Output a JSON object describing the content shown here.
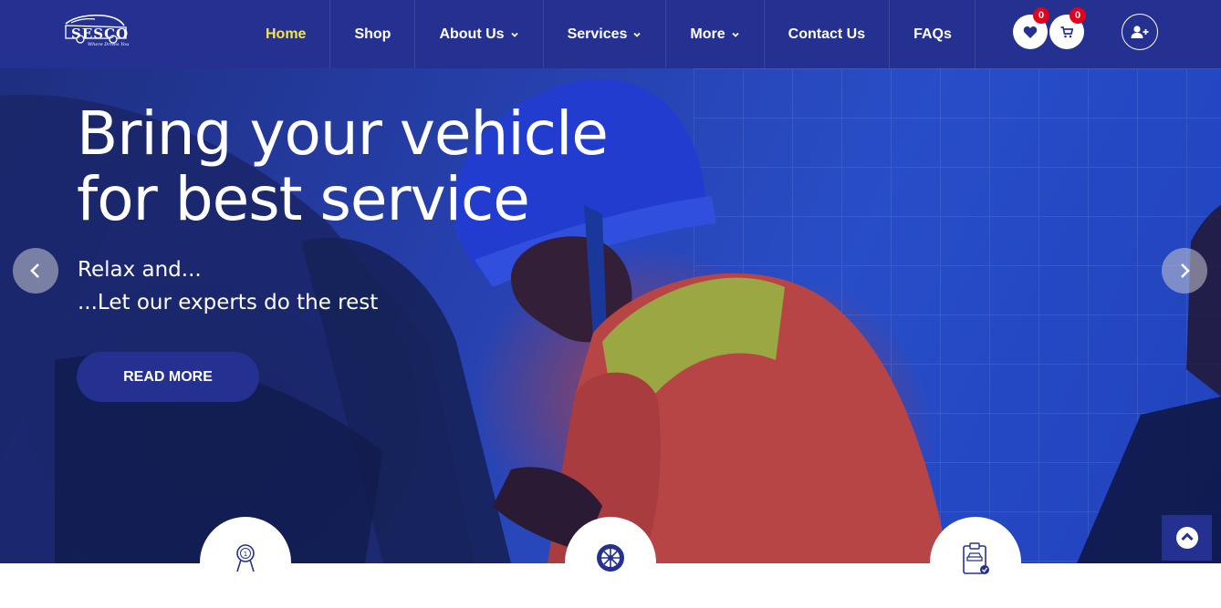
{
  "header": {
    "logo_text": "SESCO",
    "logo_tagline": "Where Drives You",
    "nav": [
      {
        "label": "Home",
        "active": true,
        "dropdown": false
      },
      {
        "label": "Shop",
        "active": false,
        "dropdown": false
      },
      {
        "label": "About Us",
        "active": false,
        "dropdown": true
      },
      {
        "label": "Services",
        "active": false,
        "dropdown": true
      },
      {
        "label": "More",
        "active": false,
        "dropdown": true
      },
      {
        "label": "Contact Us",
        "active": false,
        "dropdown": false
      },
      {
        "label": "FAQs",
        "active": false,
        "dropdown": false
      }
    ],
    "wishlist_count": "0",
    "cart_count": "0",
    "icons": {
      "wishlist": "heart-icon",
      "cart": "cart-icon",
      "account": "user-plus-icon"
    }
  },
  "hero": {
    "title_line1": "Bring your vehicle",
    "title_line2": "for best service",
    "subtitle_line1": "Relax and...",
    "subtitle_line2": "...Let our experts do the rest",
    "button_label": "READ MORE",
    "prev_icon": "chevron-left-icon",
    "next_icon": "chevron-right-icon"
  },
  "features": [
    {
      "icon": "award-ribbon-icon"
    },
    {
      "icon": "wheel-icon"
    },
    {
      "icon": "clipboard-car-icon"
    }
  ],
  "scroll_top_icon": "arrow-up-circle-icon",
  "colors": {
    "primary": "#253190",
    "active_nav": "#f5e642",
    "badge": "#e3001b",
    "white": "#ffffff"
  }
}
